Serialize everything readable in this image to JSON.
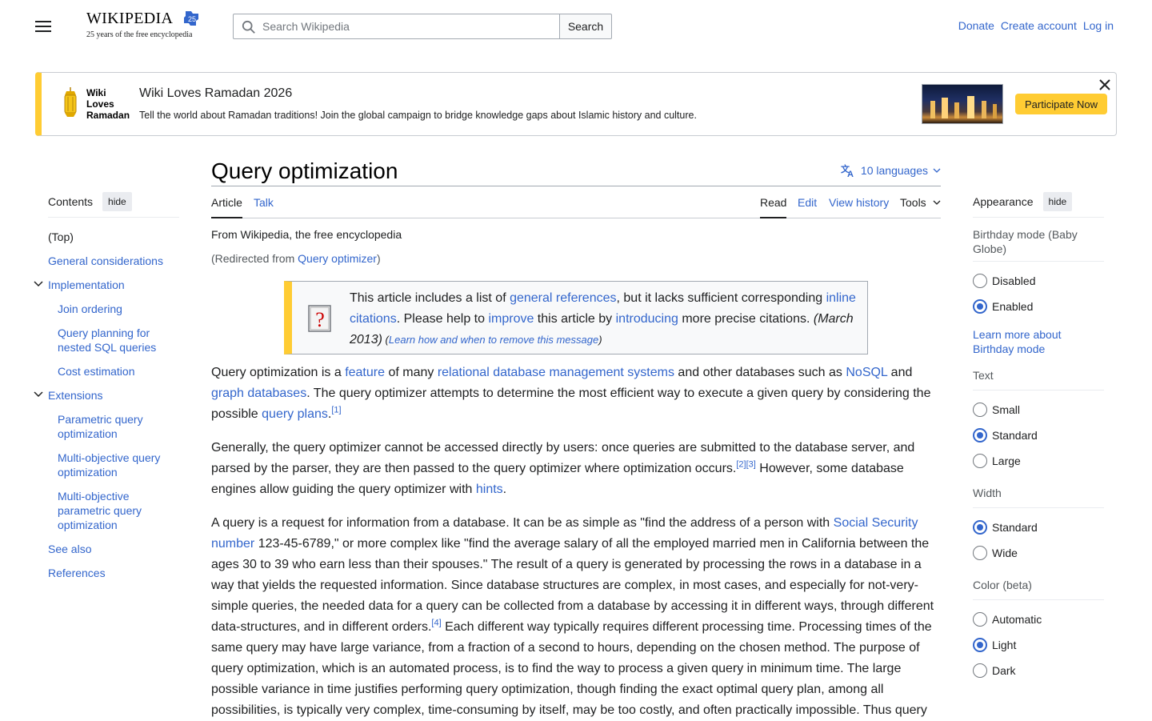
{
  "header": {
    "logo_word": "Wikipedia",
    "logo_tagline": "25 years of the free encyclopedia",
    "logo_badge": "25",
    "search_placeholder": "Search Wikipedia",
    "search_button": "Search",
    "donate": "Donate",
    "create_account": "Create account",
    "login": "Log in"
  },
  "banner": {
    "logo_line1": "Wiki",
    "logo_line2": "Loves",
    "logo_line3": "Ramadan",
    "title": "Wiki Loves Ramadan 2026",
    "subtitle": "Tell the world about Ramadan traditions! Join the global campaign to bridge knowledge gaps about Islamic history and culture.",
    "button": "Participate Now"
  },
  "toc": {
    "title": "Contents",
    "hide": "hide",
    "items": [
      {
        "label": "(Top)"
      },
      {
        "label": "General considerations"
      },
      {
        "label": "Implementation"
      },
      {
        "label": "Join ordering"
      },
      {
        "label": "Query planning for nested SQL queries"
      },
      {
        "label": "Cost estimation"
      },
      {
        "label": "Extensions"
      },
      {
        "label": "Parametric query optimization"
      },
      {
        "label": "Multi-objective query optimization"
      },
      {
        "label": "Multi-objective parametric query optimization"
      },
      {
        "label": "See also"
      },
      {
        "label": "References"
      }
    ]
  },
  "article": {
    "title": "Query optimization",
    "languages": "10 languages",
    "tabs": {
      "article": "Article",
      "talk": "Talk",
      "read": "Read",
      "edit": "Edit",
      "history": "View history",
      "tools": "Tools"
    },
    "tagline": "From Wikipedia, the free encyclopedia",
    "redirect_prefix": "(Redirected from ",
    "redirect_link": "Query optimizer",
    "redirect_suffix": ")",
    "ambox": {
      "t1": "This article includes a list of ",
      "l1": "general references",
      "t2": ", but it lacks sufficient corresponding ",
      "l2": "inline citations",
      "t3": ". Please help to ",
      "l3": "improve",
      "t4": " this article by ",
      "l4": "introducing",
      "t5": " more precise citations. ",
      "date": "(March 2013)",
      "learn_open": " (",
      "learn": "Learn how and when to remove this message",
      "learn_close": ")"
    },
    "p1": {
      "a": "Query optimization is a ",
      "l1": "feature",
      "b": " of many ",
      "l2": "relational database management systems",
      "c": " and other databases such as ",
      "l3": "NoSQL",
      "d": " and ",
      "l4": "graph databases",
      "e": ". The query optimizer attempts to determine the most efficient way to execute a given query by considering the possible ",
      "l5": "query plans",
      "f": ".",
      "ref1": "[1]"
    },
    "p2": {
      "a": "Generally, the query optimizer cannot be accessed directly by users: once queries are submitted to the database server, and parsed by the parser, they are then passed to the query optimizer where optimization occurs.",
      "ref2": "[2]",
      "ref3": "[3]",
      "b": " However, some database engines allow guiding the query optimizer with ",
      "l1": "hints",
      "c": "."
    },
    "p3": {
      "a": "A query is a request for information from a database. It can be as simple as \"find the address of a person with ",
      "l1": "Social Security number",
      "b": " 123-45-6789,\" or more complex like \"find the average salary of all the employed married men in California between the ages 30 to 39 who earn less than their spouses.\" The result of a query is generated by processing the rows in a database in a way that yields the requested information. Since database structures are complex, in most cases, and especially for not-very-simple queries, the needed data for a query can be collected from a database by accessing it in different ways, through different data-structures, and in different orders.",
      "ref4": "[4]",
      "c": " Each different way typically requires different processing time. Processing times of the same query may have large variance, from a fraction of a second to hours, depending on the chosen method. The purpose of query optimization, which is an automated process, is to find the way to process a given query in minimum time. The large possible variance in time justifies performing query optimization, though finding the exact optimal query plan, among all possibilities, is typically very complex, time-consuming by itself, may be too costly, and often practically impossible. Thus query"
    }
  },
  "appearance": {
    "title": "Appearance",
    "hide": "hide",
    "birthday_label": "Birthday mode (Baby Globe)",
    "birthday_options": [
      "Disabled",
      "Enabled"
    ],
    "birthday_selected": "Enabled",
    "learn_more": "Learn more about Birthday mode",
    "text_label": "Text",
    "text_options": [
      "Small",
      "Standard",
      "Large"
    ],
    "text_selected": "Standard",
    "width_label": "Width",
    "width_options": [
      "Standard",
      "Wide"
    ],
    "width_selected": "Standard",
    "color_label": "Color (beta)",
    "color_options": [
      "Automatic",
      "Light",
      "Dark"
    ],
    "color_selected": "Light"
  },
  "colors": {
    "link": "#3366cc",
    "banner_accent": "#ffcc33",
    "text": "#202122"
  }
}
